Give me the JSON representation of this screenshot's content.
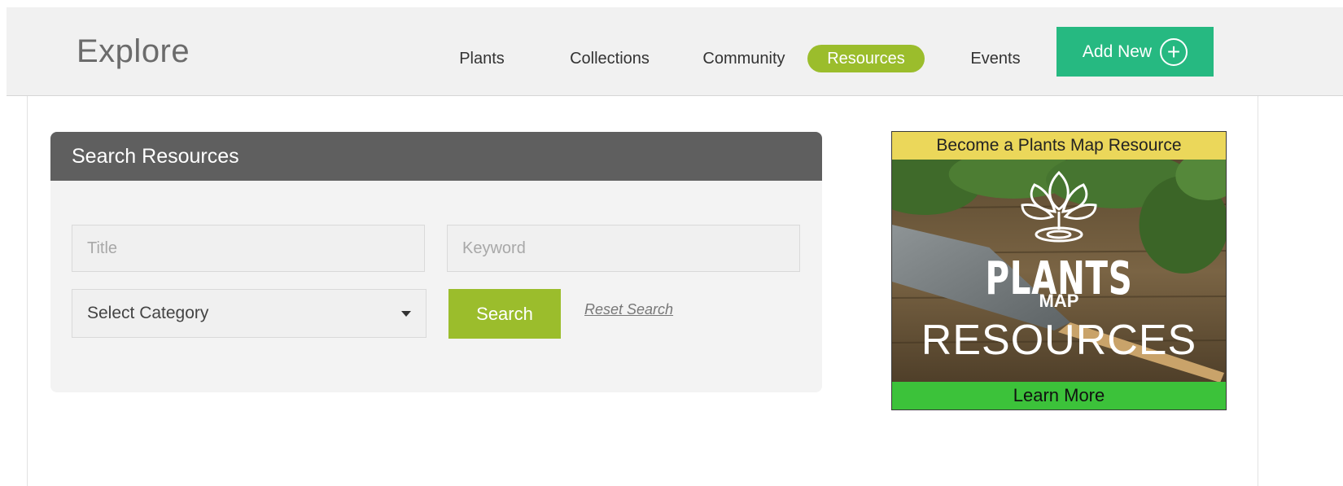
{
  "header": {
    "brand": "Explore",
    "nav": [
      {
        "label": "Plants",
        "active": false
      },
      {
        "label": "Collections",
        "active": false
      },
      {
        "label": "Community",
        "active": false
      },
      {
        "label": "Resources",
        "active": true
      },
      {
        "label": "Events",
        "active": false
      }
    ],
    "add_new_label": "Add New",
    "add_new_icon": "plus-circle-icon"
  },
  "search_panel": {
    "title": "Search Resources",
    "title_placeholder": "Title",
    "keyword_placeholder": "Keyword",
    "category_label": "Select Category",
    "search_label": "Search",
    "reset_label": "Reset Search"
  },
  "ad": {
    "top_text": "Become a Plants Map Resource",
    "logo_plants": "PLANTS",
    "logo_map": "MAP",
    "logo_resources": "RESOURCES",
    "bottom_text": "Learn More"
  },
  "colors": {
    "accent_green": "#9bbd2c",
    "add_new_teal": "#26b981",
    "panel_header": "#5f5f5f",
    "ad_banner_yellow": "#ebd75a",
    "ad_banner_green": "#3cc23a"
  }
}
